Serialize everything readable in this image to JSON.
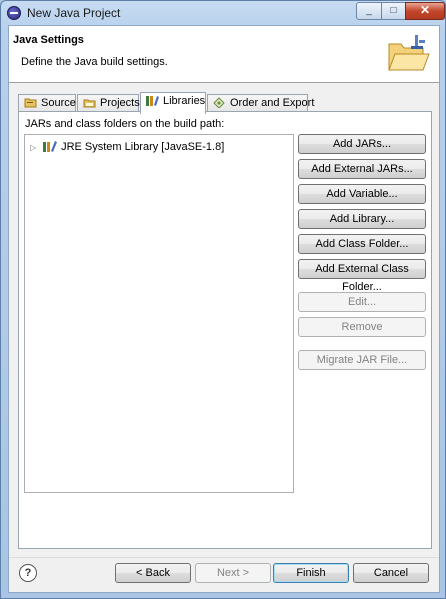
{
  "window": {
    "title": "New Java Project",
    "close_glyph": "✕",
    "max_glyph": "□",
    "min_glyph": "_"
  },
  "header": {
    "title": "Java Settings",
    "description": "Define the Java build settings."
  },
  "tabs": [
    {
      "label": "Source",
      "icon": "source-folder-icon"
    },
    {
      "label": "Projects",
      "icon": "projects-icon"
    },
    {
      "label": "Libraries",
      "icon": "libraries-icon",
      "active": true
    },
    {
      "label": "Order and Export",
      "icon": "order-export-icon"
    }
  ],
  "libraries": {
    "label": "JARs and class folders on the build path:",
    "tree": [
      {
        "label": "JRE System Library [JavaSE-1.8]",
        "expanded": false
      }
    ],
    "buttons": {
      "add_jars": "Add JARs...",
      "add_external_jars": "Add External JARs...",
      "add_variable": "Add Variable...",
      "add_library": "Add Library...",
      "add_class_folder": "Add Class Folder...",
      "add_external_class_folder": "Add External Class Folder...",
      "edit": "Edit...",
      "remove": "Remove",
      "migrate_jar": "Migrate JAR File..."
    }
  },
  "footer": {
    "help": "?",
    "back": "< Back",
    "next": "Next >",
    "finish": "Finish",
    "cancel": "Cancel"
  }
}
